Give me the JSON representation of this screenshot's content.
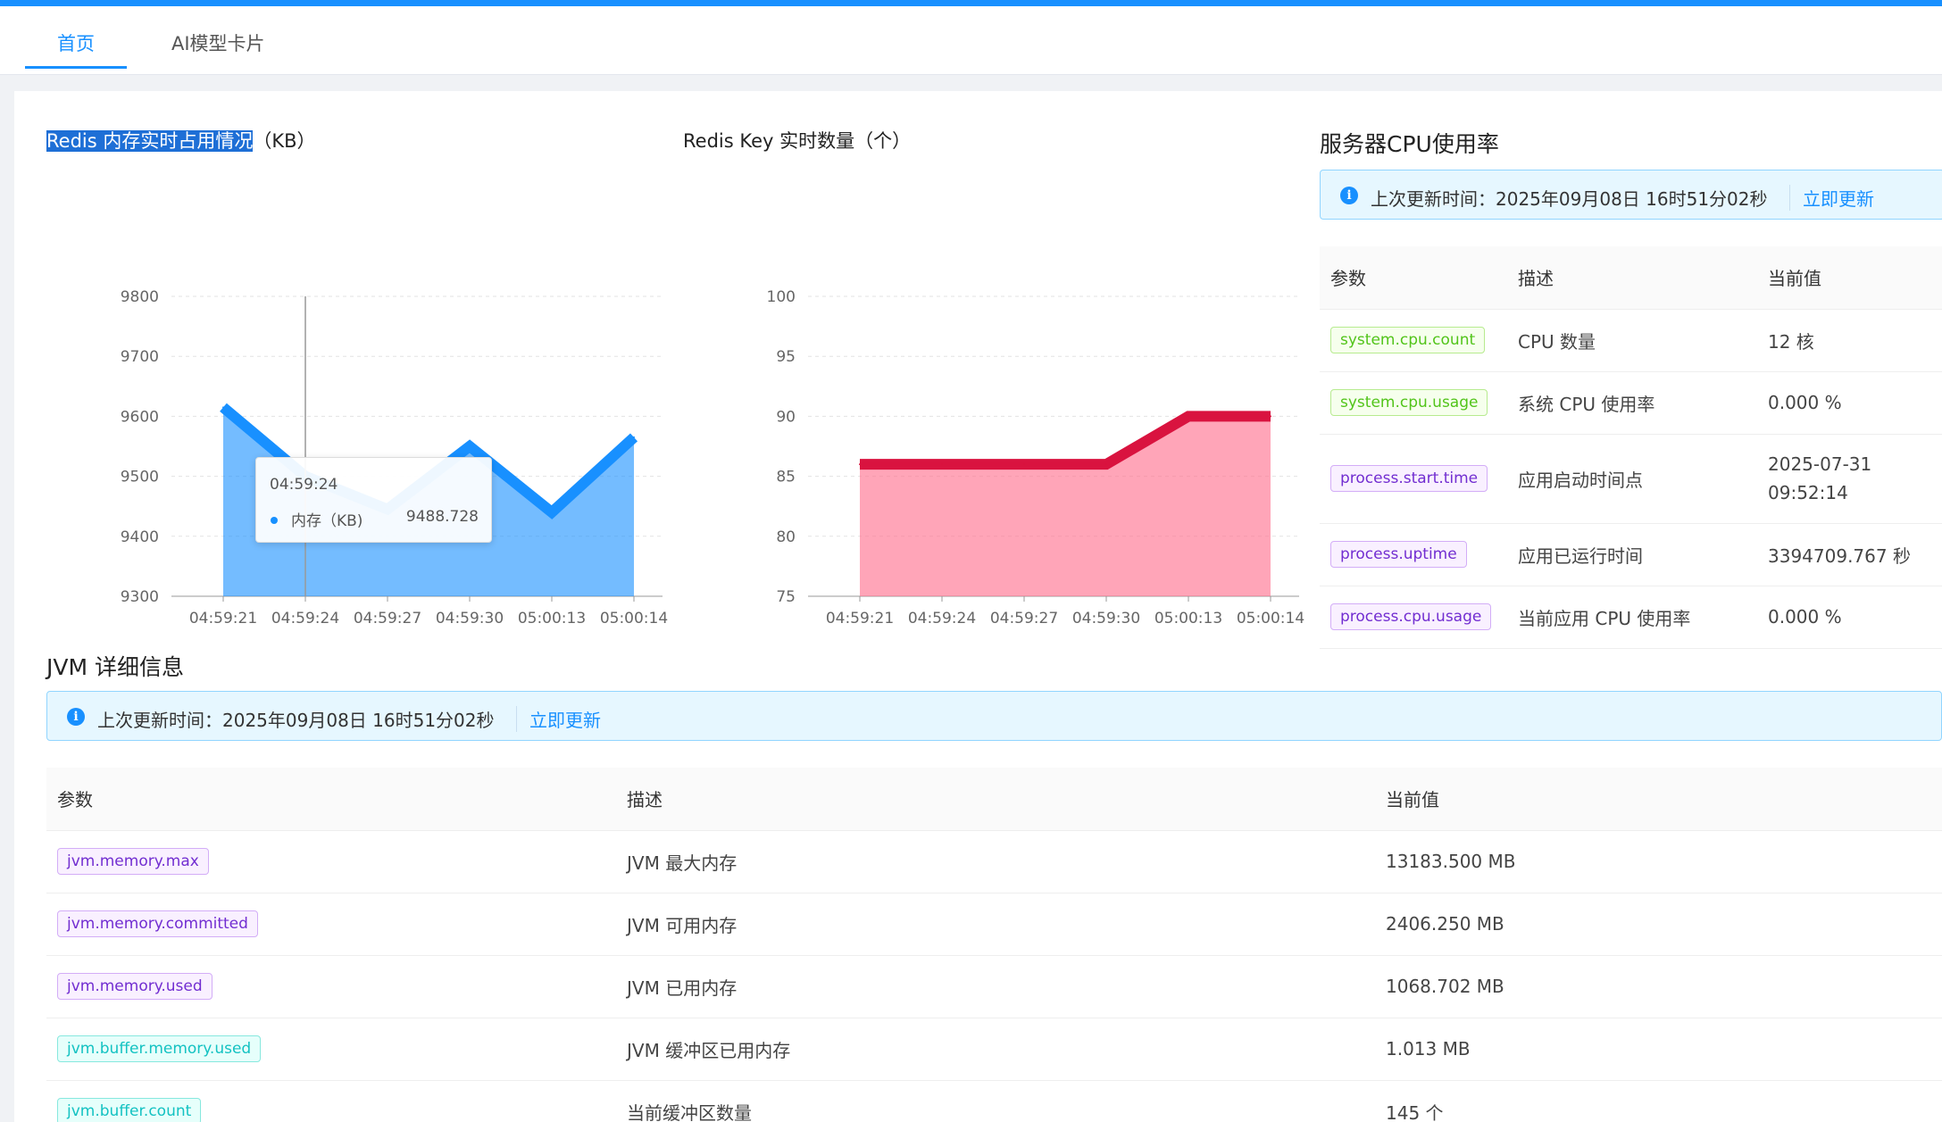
{
  "tabs": [
    {
      "label": "首页",
      "active": true
    },
    {
      "label": "AI模型卡片",
      "active": false
    }
  ],
  "redis_memory": {
    "title_highlight": "Redis 内存实时占用情况",
    "title_rest": "（KB）",
    "tooltip": {
      "time": "04:59:24",
      "label": "内存（KB)",
      "value": "9488.728"
    }
  },
  "redis_keys": {
    "title": "Redis Key 实时数量（个）"
  },
  "chart_data": [
    {
      "type": "area",
      "title": "Redis 内存实时占用情况（KB）",
      "x": [
        "04:59:21",
        "04:59:24",
        "04:59:27",
        "04:59:30",
        "05:00:13",
        "05:00:14"
      ],
      "series": [
        {
          "values": [
            9615,
            9500,
            9445,
            9550,
            9440,
            9565
          ]
        }
      ],
      "y_ticks": [
        9300,
        9400,
        9500,
        9600,
        9700,
        9800
      ],
      "ylim": [
        9300,
        9800
      ],
      "color": "#1890ff",
      "grid": true
    },
    {
      "type": "area",
      "title": "Redis Key 实时数量（个）",
      "x": [
        "04:59:21",
        "04:59:24",
        "04:59:27",
        "04:59:30",
        "05:00:13",
        "05:00:14"
      ],
      "series": [
        {
          "values": [
            86,
            86,
            86,
            86,
            90,
            90
          ]
        }
      ],
      "y_ticks": [
        75,
        80,
        85,
        90,
        95,
        100
      ],
      "ylim": [
        75,
        100
      ],
      "color": "#d9133f",
      "grid": true
    }
  ],
  "cpu": {
    "title": "服务器CPU使用率",
    "alert_text": "上次更新时间：2025年09月08日 16时51分02秒",
    "alert_link": "立即更新",
    "headers": [
      "参数",
      "描述",
      "当前值"
    ],
    "rows": [
      {
        "param": "system.cpu.count",
        "tag": "green",
        "desc": "CPU 数量",
        "value": "12 核",
        "value2": ""
      },
      {
        "param": "system.cpu.usage",
        "tag": "green",
        "desc": "系统 CPU 使用率",
        "value": "0.000 %",
        "value2": ""
      },
      {
        "param": "process.start.time",
        "tag": "purple",
        "desc": "应用启动时间点",
        "value": "2025-07-31",
        "value2": "09:52:14"
      },
      {
        "param": "process.uptime",
        "tag": "purple",
        "desc": "应用已运行时间",
        "value": "3394709.767 秒",
        "value2": ""
      },
      {
        "param": "process.cpu.usage",
        "tag": "purple",
        "desc": "当前应用 CPU 使用率",
        "value": "0.000 %",
        "value2": ""
      }
    ]
  },
  "jvm": {
    "title": "JVM 详细信息",
    "alert_text": "上次更新时间：2025年09月08日 16时51分02秒",
    "alert_link": "立即更新",
    "headers": [
      "参数",
      "描述",
      "当前值"
    ],
    "rows": [
      {
        "param": "jvm.memory.max",
        "tag": "purple",
        "desc": "JVM 最大内存",
        "value": "13183.500 MB"
      },
      {
        "param": "jvm.memory.committed",
        "tag": "purple",
        "desc": "JVM 可用内存",
        "value": "2406.250 MB"
      },
      {
        "param": "jvm.memory.used",
        "tag": "purple",
        "desc": "JVM 已用内存",
        "value": "1068.702 MB"
      },
      {
        "param": "jvm.buffer.memory.used",
        "tag": "cyan",
        "desc": "JVM 缓冲区已用内存",
        "value": "1.013 MB"
      },
      {
        "param": "jvm.buffer.count",
        "tag": "cyan",
        "desc": "当前缓冲区数量",
        "value": "145 个"
      }
    ]
  }
}
